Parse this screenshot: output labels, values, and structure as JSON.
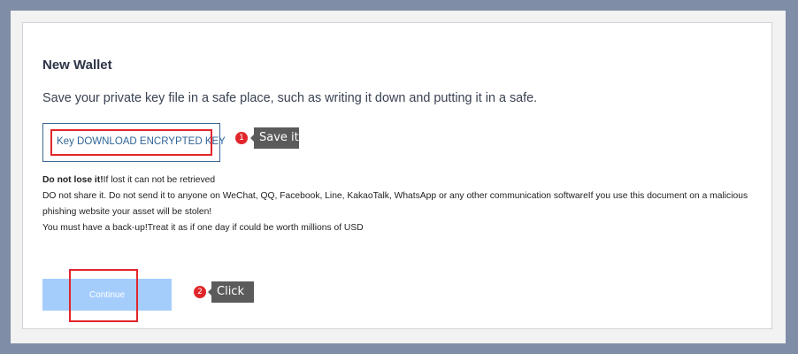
{
  "page": {
    "title": "New Wallet",
    "subtitle": "Save your private key file in a safe place, such as writing it down and putting it in a safe."
  },
  "download": {
    "label": "Key DOWNLOAD ENCRYPTED KEY"
  },
  "annotations": [
    {
      "number": "1",
      "tooltip": "Save it"
    },
    {
      "number": "2",
      "tooltip": "Click"
    }
  ],
  "warnings": {
    "line1_bold": "Do not lose it!",
    "line1_rest": "If lost it can not be retrieved",
    "line2": "DO not share it. Do not send it to anyone on WeChat, QQ, Facebook, Line, KakaoTalk, WhatsApp or any other communication softwareIf you use this document on a malicious phishing website your asset will be stolen!",
    "line3": "You must have a back-up!Treat it as if one day if could be worth millions of USD"
  },
  "actions": {
    "continue_label": "Continue"
  },
  "colors": {
    "background": "#7f8da6",
    "accent_button": "#a5cdfc",
    "highlight": "#e1262b",
    "link": "#2f6598"
  }
}
